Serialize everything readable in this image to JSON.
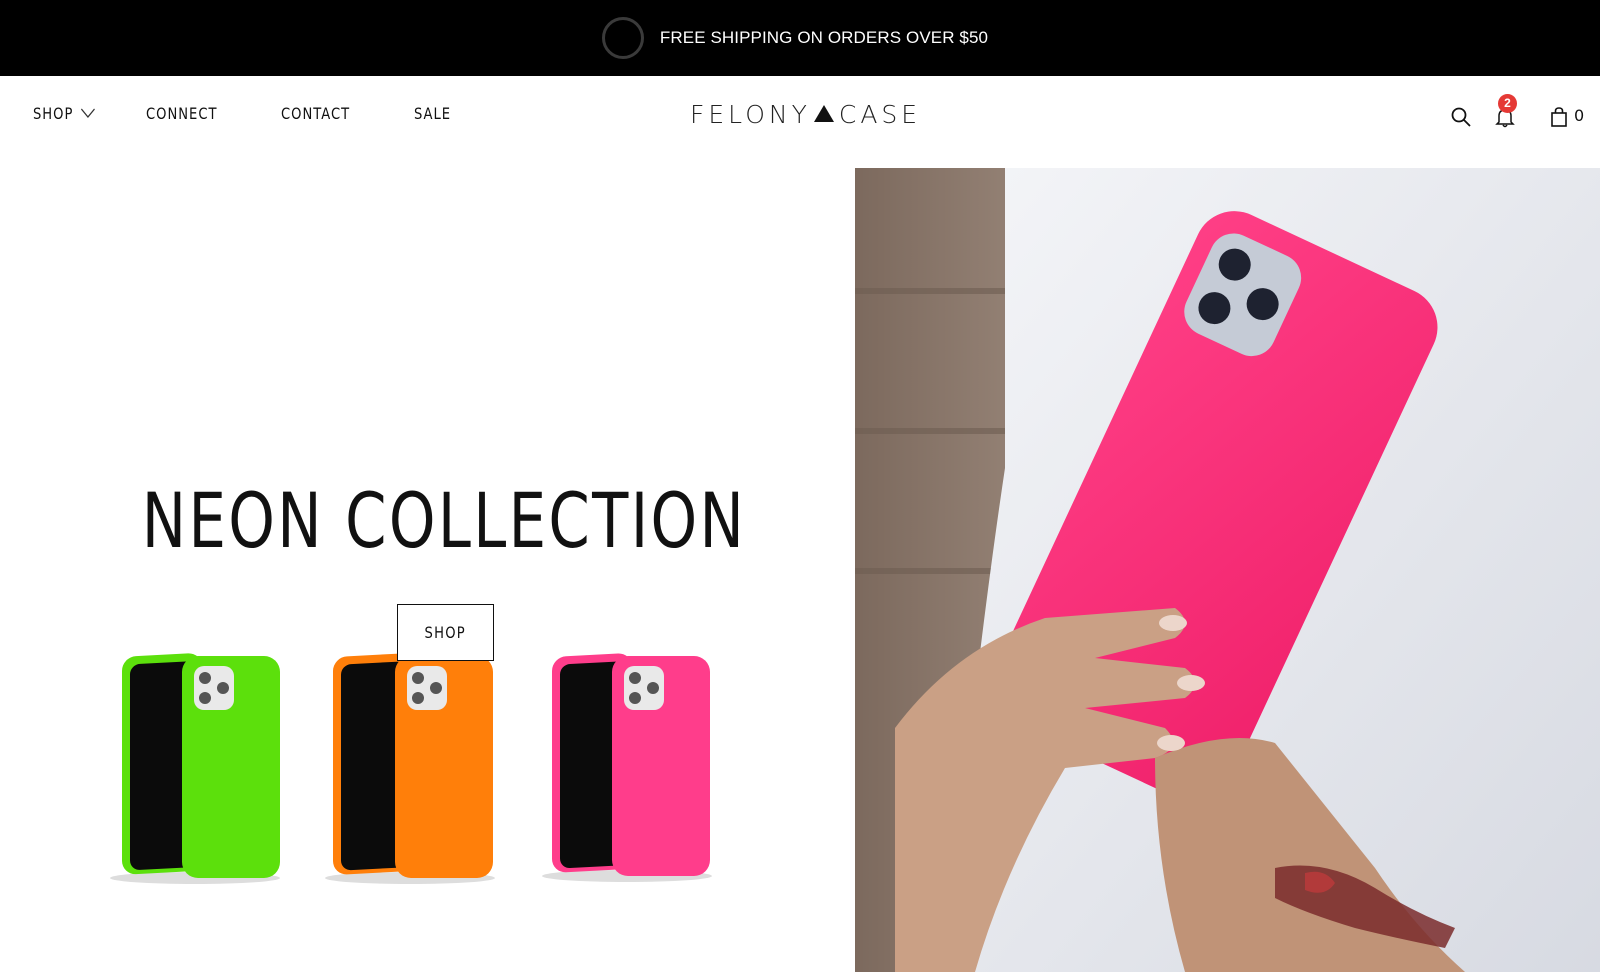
{
  "announcement": {
    "text": "FREE SHIPPING ON ORDERS OVER $50"
  },
  "nav": {
    "items": [
      {
        "label": "SHOP",
        "has_dropdown": true
      },
      {
        "label": "CONNECT"
      },
      {
        "label": "CONTACT"
      },
      {
        "label": "SALE"
      }
    ]
  },
  "logo": {
    "left": "FELONY",
    "right": "CASE"
  },
  "header_icons": {
    "search": "search-icon",
    "notifications": "bell-icon",
    "notification_count": "2",
    "cart": "shopping-bag-icon",
    "cart_count": "0"
  },
  "hero": {
    "title": "NEON COLLECTION",
    "button_label": "SHOP",
    "products": [
      {
        "name": "neon-green-case",
        "color": "#5ce00c"
      },
      {
        "name": "neon-orange-case",
        "color": "#ff7f0a"
      },
      {
        "name": "neon-pink-case",
        "color": "#ff3d8b"
      }
    ],
    "image_case_color": "#ff2f7a"
  },
  "colors": {
    "announcement_bg": "#000000",
    "badge": "#e53935"
  }
}
